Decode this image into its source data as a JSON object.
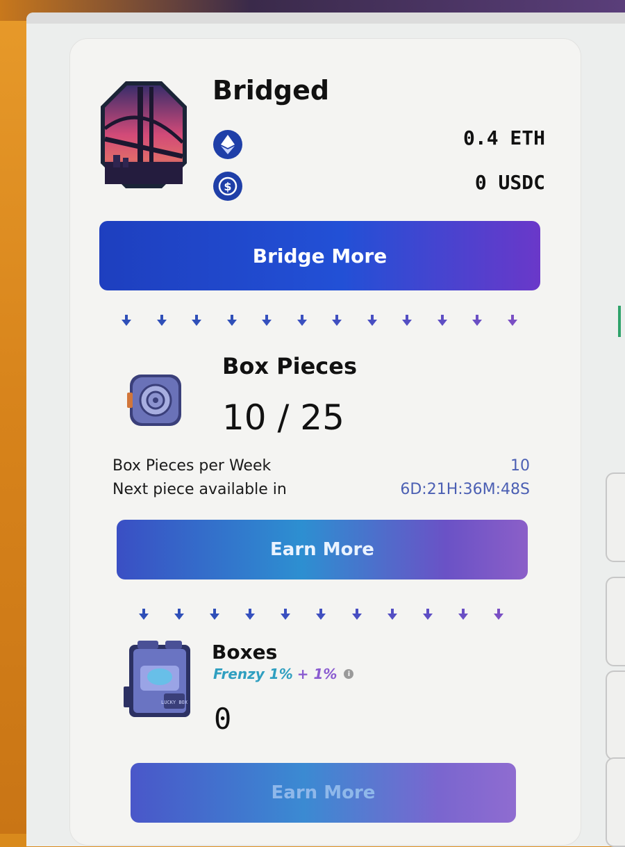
{
  "bridged": {
    "title": "Bridged",
    "tokens": [
      {
        "icon": "eth-icon",
        "amount": "0.4 ETH"
      },
      {
        "icon": "usdc-icon",
        "amount": "0 USDC"
      }
    ],
    "button_label": "Bridge More"
  },
  "box_pieces": {
    "title": "Box Pieces",
    "count": "10 / 25",
    "per_week_label": "Box Pieces per Week",
    "per_week_value": "10",
    "next_label": "Next piece available in",
    "next_value": "6D:21H:36M:48S",
    "button_label": "Earn More"
  },
  "boxes": {
    "title": "Boxes",
    "frenzy_a": "Frenzy 1%",
    "frenzy_b": "+ 1%",
    "info_glyph": "i",
    "count": "0",
    "box_art_text": "LUCKY BOX",
    "button_label": "Earn More"
  },
  "colors": {
    "accent_blue": "#2250d6",
    "accent_purple": "#6a38c9",
    "arrow_blue": "#2f4fb8",
    "arrow_purple": "#7a4fc4"
  }
}
